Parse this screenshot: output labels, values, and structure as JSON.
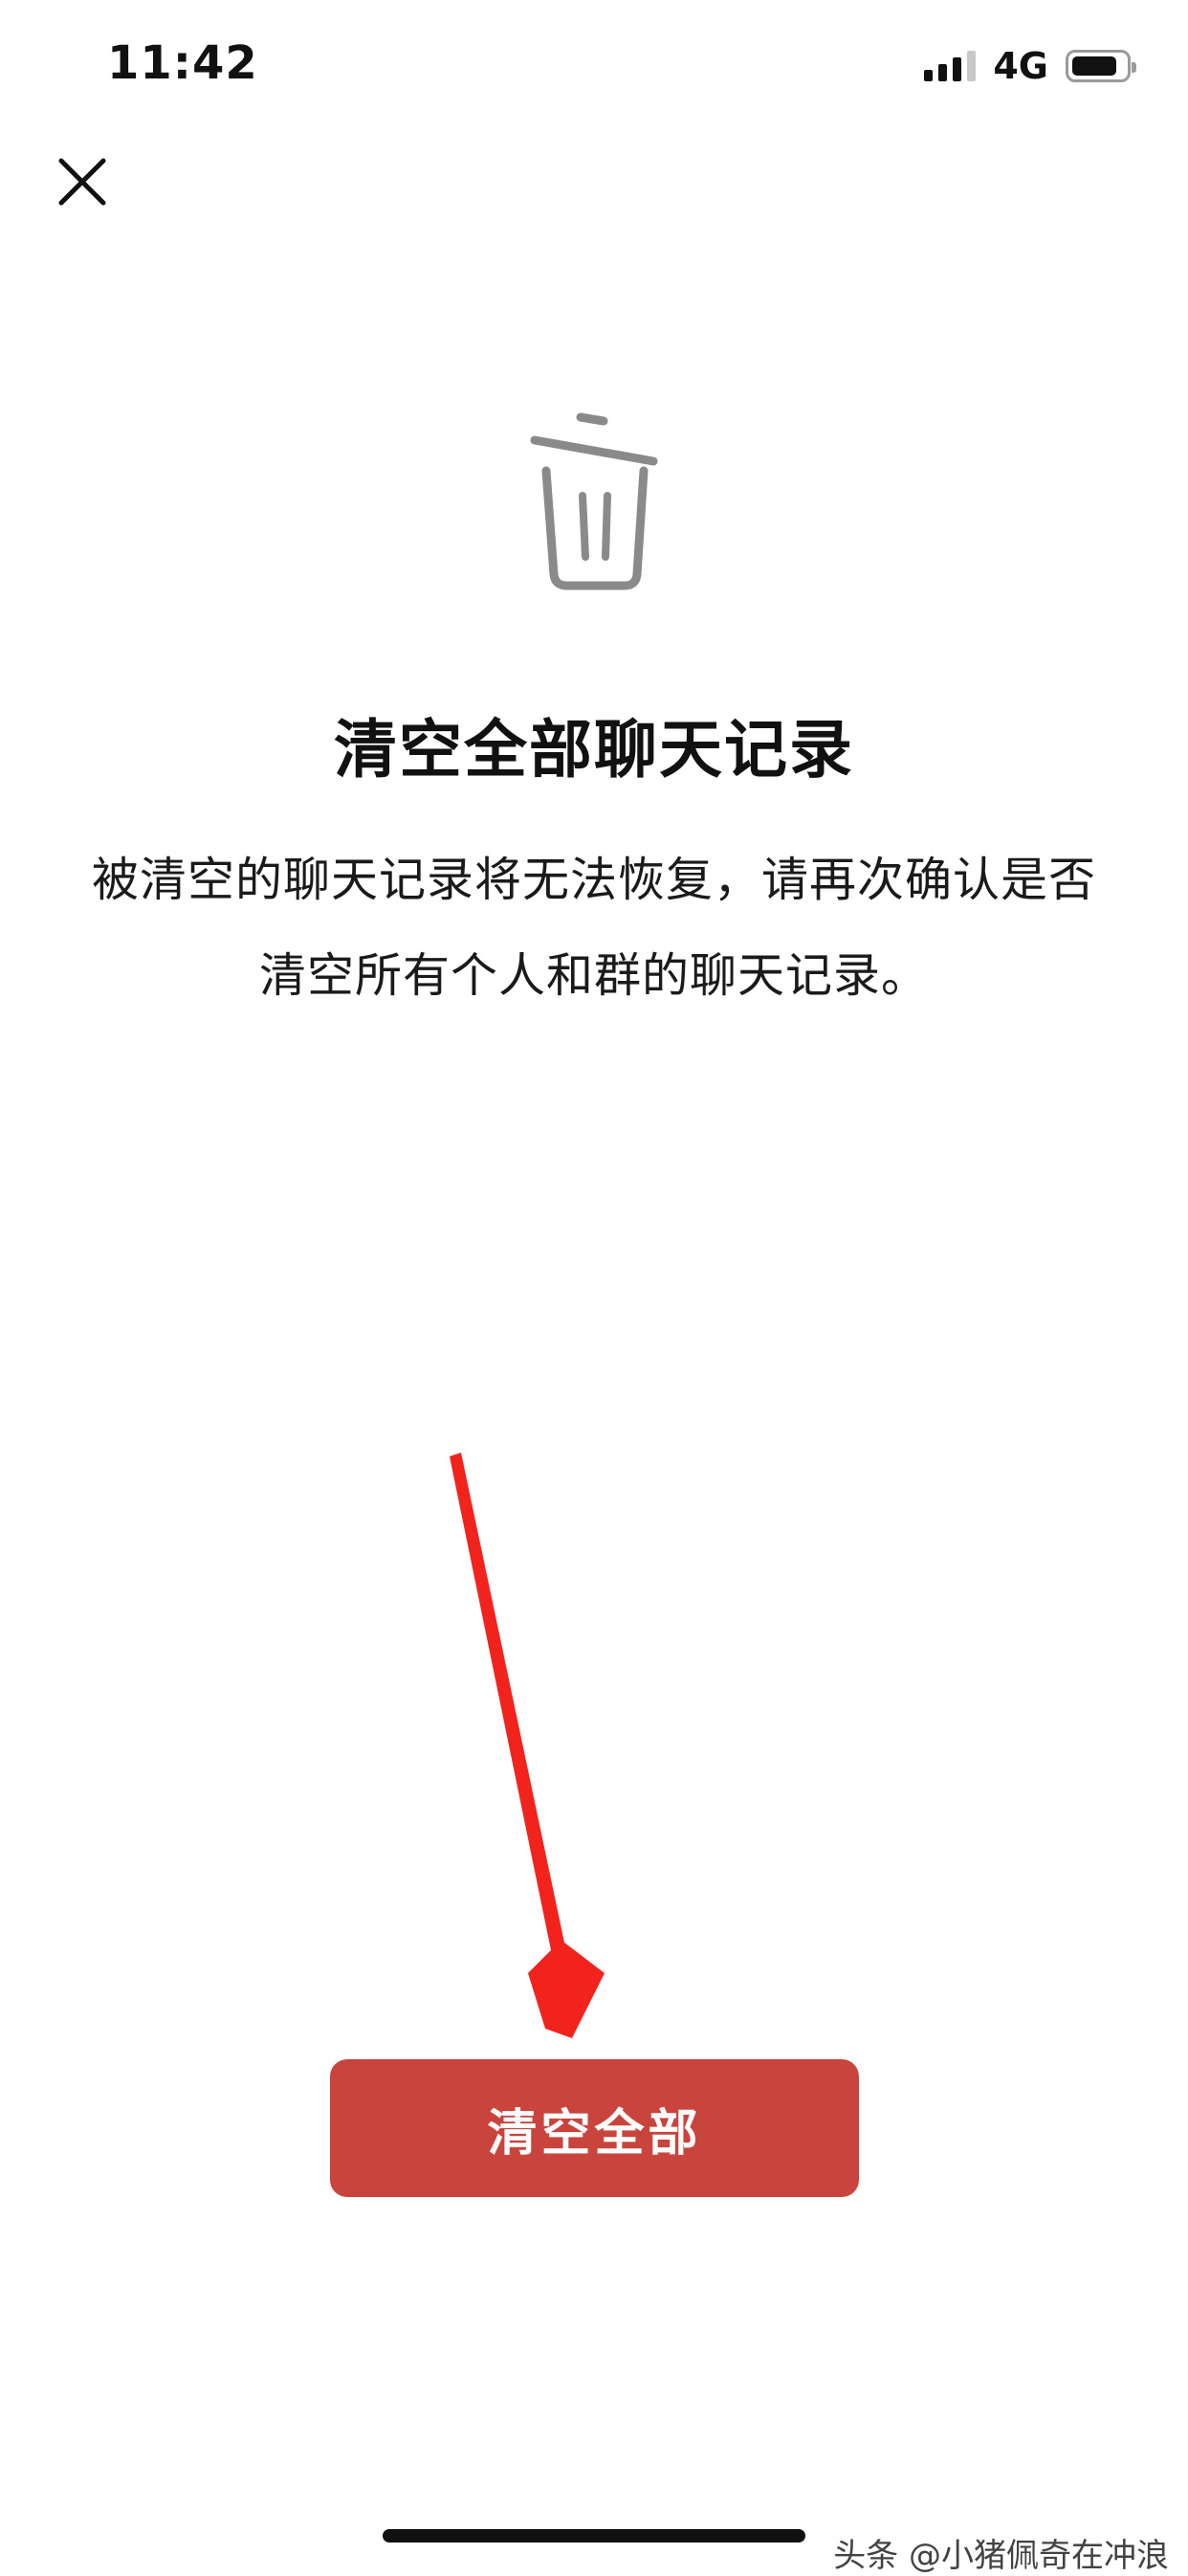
{
  "status_bar": {
    "time": "11:42",
    "network": "4G",
    "icons": [
      "signal-icon",
      "battery-icon"
    ],
    "battery_level": 0.85
  },
  "header": {
    "close_icon": "close-icon"
  },
  "main": {
    "icon": "trash-icon",
    "title": "清空全部聊天记录",
    "description": "被清空的聊天记录将无法恢复，请再次确认是否清空所有个人和群的聊天记录。"
  },
  "actions": {
    "clear_all_label": "清空全部"
  },
  "annotations": {
    "arrow_icon": "red-arrow-icon"
  },
  "watermark": {
    "text": "头条 @小猪佩奇在冲浪"
  },
  "colors": {
    "primary_button": "#c9443c",
    "annotation_arrow": "#f2231c",
    "icon_gray": "#8a8a8a"
  }
}
